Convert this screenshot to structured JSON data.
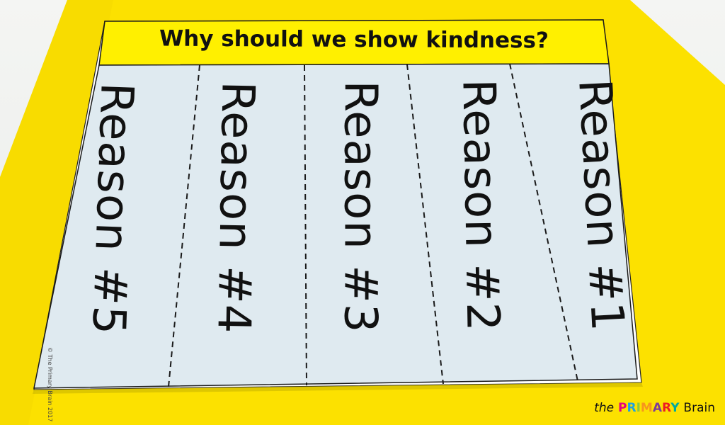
{
  "title": "Why should we show kindness?",
  "flaps": [
    {
      "label": "Reason #5"
    },
    {
      "label": "Reason #4"
    },
    {
      "label": "Reason #3"
    },
    {
      "label": "Reason #2"
    },
    {
      "label": "Reason #1"
    }
  ],
  "copyright": "© The Primary Brain 2017",
  "brand": {
    "prefix": "the",
    "highlight": "PRIMARY",
    "suffix": "Brain",
    "highlight_colors": [
      "#e6007e",
      "#1da1e2",
      "#8cc63f",
      "#f7941d",
      "#7d3c98",
      "#ed1c24",
      "#00a99d"
    ]
  },
  "colors": {
    "board": "#fce100",
    "title_band": "#fff000",
    "paper": "#dce9ef",
    "outline": "#1a1a1a"
  }
}
